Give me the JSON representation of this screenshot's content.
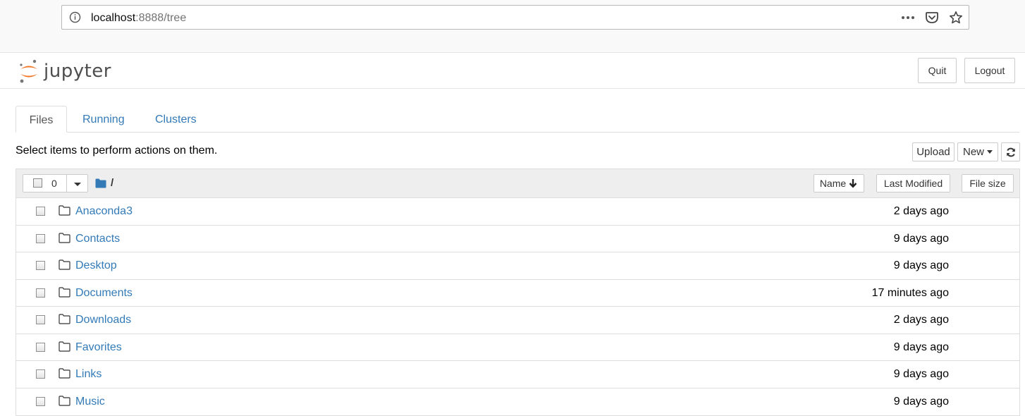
{
  "browser": {
    "url_host": "localhost",
    "url_rest": ":8888/tree"
  },
  "header": {
    "logo_text": "jupyter",
    "quit_label": "Quit",
    "logout_label": "Logout"
  },
  "tabs": [
    {
      "label": "Files",
      "active": true
    },
    {
      "label": "Running",
      "active": false
    },
    {
      "label": "Clusters",
      "active": false
    }
  ],
  "toolbar": {
    "hint": "Select items to perform actions on them.",
    "upload_label": "Upload",
    "new_label": "New"
  },
  "list_header": {
    "selected_count": "0",
    "breadcrumb": "/",
    "sort_name_label": "Name",
    "sort_modified_label": "Last Modified",
    "sort_size_label": "File size"
  },
  "files": [
    {
      "name": "Anaconda3",
      "modified": "2 days ago"
    },
    {
      "name": "Contacts",
      "modified": "9 days ago"
    },
    {
      "name": "Desktop",
      "modified": "9 days ago"
    },
    {
      "name": "Documents",
      "modified": "17 minutes ago"
    },
    {
      "name": "Downloads",
      "modified": "2 days ago"
    },
    {
      "name": "Favorites",
      "modified": "9 days ago"
    },
    {
      "name": "Links",
      "modified": "9 days ago"
    },
    {
      "name": "Music",
      "modified": "9 days ago"
    }
  ],
  "colors": {
    "link": "#337ab7",
    "jupyter_orange": "#f37726",
    "folder_blue": "#337ab7"
  },
  "icons": {
    "url_info": "info-icon",
    "page_actions": "more-icon",
    "pocket": "pocket-icon",
    "bookmark": "star-icon",
    "refresh": "refresh-icon",
    "folder": "folder-icon",
    "breadcrumb_folder": "folder-filled-icon",
    "sort_arrow": "arrow-down-icon"
  }
}
